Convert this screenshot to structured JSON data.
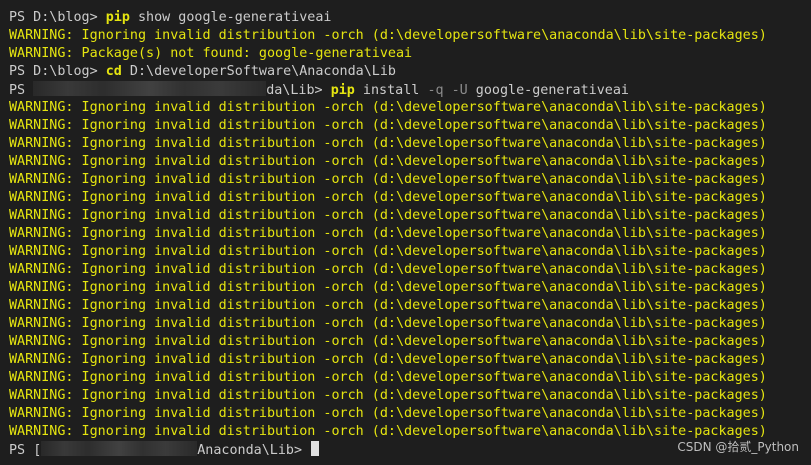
{
  "terminal": {
    "line1": {
      "prompt": "PS D:\\blog> ",
      "cmd": "pip",
      "rest": " show google-generativeai"
    },
    "line2": "WARNING: Ignoring invalid distribution -orch (d:\\developersoftware\\anaconda\\lib\\site-packages)",
    "line3": "WARNING: Package(s) not found: google-generativeai",
    "line4": {
      "prompt": "PS D:\\blog> ",
      "cmd": "cd",
      "rest": " D:\\developerSoftware\\Anaconda\\Lib"
    },
    "line5": {
      "prompt_start": "PS ",
      "prompt_end": "da\\Lib> ",
      "cmd": "pip",
      "rest1": " install ",
      "flags": "-q -U",
      "rest2": " google-generativeai"
    },
    "warnings": [
      "WARNING: Ignoring invalid distribution -orch (d:\\developersoftware\\anaconda\\lib\\site-packages)",
      "WARNING: Ignoring invalid distribution -orch (d:\\developersoftware\\anaconda\\lib\\site-packages)",
      "WARNING: Ignoring invalid distribution -orch (d:\\developersoftware\\anaconda\\lib\\site-packages)",
      "WARNING: Ignoring invalid distribution -orch (d:\\developersoftware\\anaconda\\lib\\site-packages)",
      "WARNING: Ignoring invalid distribution -orch (d:\\developersoftware\\anaconda\\lib\\site-packages)",
      "WARNING: Ignoring invalid distribution -orch (d:\\developersoftware\\anaconda\\lib\\site-packages)",
      "WARNING: Ignoring invalid distribution -orch (d:\\developersoftware\\anaconda\\lib\\site-packages)",
      "WARNING: Ignoring invalid distribution -orch (d:\\developersoftware\\anaconda\\lib\\site-packages)",
      "WARNING: Ignoring invalid distribution -orch (d:\\developersoftware\\anaconda\\lib\\site-packages)",
      "WARNING: Ignoring invalid distribution -orch (d:\\developersoftware\\anaconda\\lib\\site-packages)",
      "WARNING: Ignoring invalid distribution -orch (d:\\developersoftware\\anaconda\\lib\\site-packages)",
      "WARNING: Ignoring invalid distribution -orch (d:\\developersoftware\\anaconda\\lib\\site-packages)",
      "WARNING: Ignoring invalid distribution -orch (d:\\developersoftware\\anaconda\\lib\\site-packages)",
      "WARNING: Ignoring invalid distribution -orch (d:\\developersoftware\\anaconda\\lib\\site-packages)",
      "WARNING: Ignoring invalid distribution -orch (d:\\developersoftware\\anaconda\\lib\\site-packages)",
      "WARNING: Ignoring invalid distribution -orch (d:\\developersoftware\\anaconda\\lib\\site-packages)",
      "WARNING: Ignoring invalid distribution -orch (d:\\developersoftware\\anaconda\\lib\\site-packages)",
      "WARNING: Ignoring invalid distribution -orch (d:\\developersoftware\\anaconda\\lib\\site-packages)",
      "WARNING: Ignoring invalid distribution -orch (d:\\developersoftware\\anaconda\\lib\\site-packages)"
    ],
    "final_prompt": {
      "start": "PS ",
      "start2": "[",
      "end": "Anaconda\\Lib> "
    }
  },
  "watermark": "CSDN @拾贰_Python",
  "colors": {
    "background": "#1e1e1e",
    "warning": "#e5e510",
    "text": "#cccccc",
    "flag": "#8c8c8c"
  }
}
